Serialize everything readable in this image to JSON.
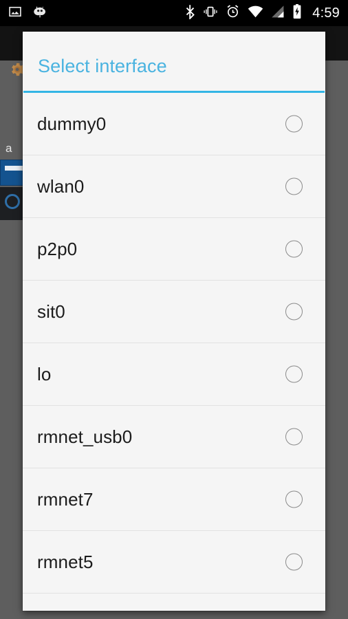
{
  "status_bar": {
    "left_icons": [
      {
        "name": "image-icon",
        "glyph": "image"
      },
      {
        "name": "cyanogenmod-icon",
        "glyph": "cid-head"
      }
    ],
    "right_icons": [
      {
        "name": "bluetooth-icon",
        "glyph": "bluetooth"
      },
      {
        "name": "vibrate-icon",
        "glyph": "vibrate"
      },
      {
        "name": "alarm-icon",
        "glyph": "alarm"
      },
      {
        "name": "wifi-icon",
        "glyph": "wifi"
      },
      {
        "name": "cell-signal-icon",
        "glyph": "signal"
      },
      {
        "name": "battery-charging-icon",
        "glyph": "battery-charging"
      }
    ],
    "clock": "4:59",
    "background": "#000000"
  },
  "backdrop": {
    "app_bar_color": "#131313",
    "scrim_color": "#5e5e5e",
    "gear_icon": "gear-icon",
    "partial_label": "a"
  },
  "dialog": {
    "title": "Select interface",
    "accent_color": "#33b5e5",
    "title_color": "#4ab3e0",
    "surface_color": "#f5f5f5",
    "divider_color": "#e2e2e2",
    "items": [
      {
        "label": "dummy0",
        "selected": false
      },
      {
        "label": "wlan0",
        "selected": false
      },
      {
        "label": "p2p0",
        "selected": false
      },
      {
        "label": "sit0",
        "selected": false
      },
      {
        "label": "lo",
        "selected": false
      },
      {
        "label": "rmnet_usb0",
        "selected": false
      },
      {
        "label": "rmnet7",
        "selected": false
      },
      {
        "label": "rmnet5",
        "selected": false
      }
    ]
  }
}
